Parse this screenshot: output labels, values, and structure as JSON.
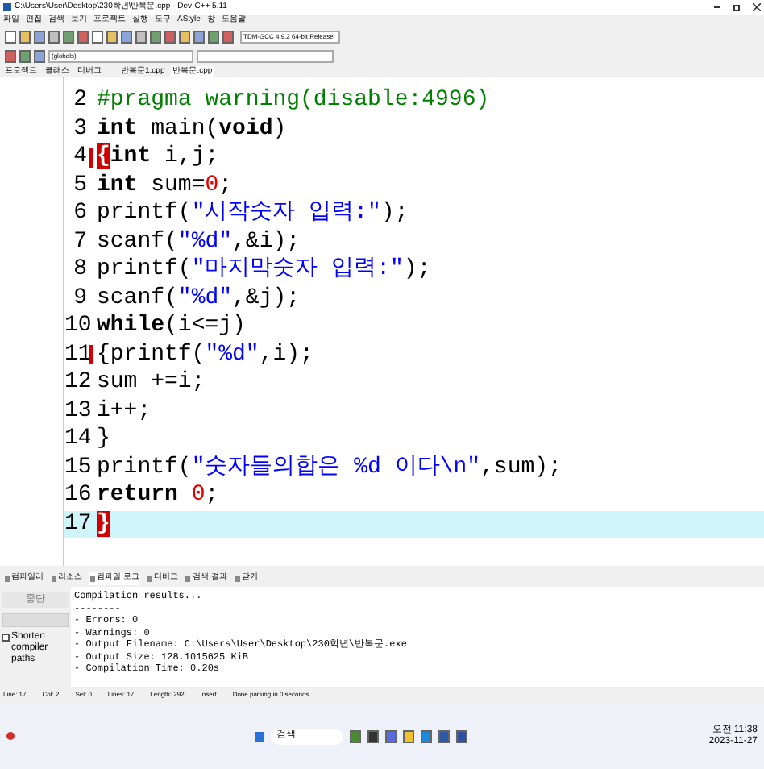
{
  "window": {
    "title": "C:\\Users\\User\\Desktop\\230학년\\반복문.cpp - Dev-C++ 5.11"
  },
  "menu": [
    "파일",
    "편집",
    "검색",
    "보기",
    "프로젝트",
    "실행",
    "도구",
    "AStyle",
    "창",
    "도움말"
  ],
  "compiler_select": {
    "value": "TDM-GCC 4.9.2 64-bit Release"
  },
  "class_select": {
    "value": "(globals)"
  },
  "side_tabs": [
    {
      "label": "프로젝트",
      "selected": false
    },
    {
      "label": "클래스",
      "selected": false
    },
    {
      "label": "디버그",
      "selected": false
    }
  ],
  "file_tabs": [
    {
      "label": "반복문1.cpp",
      "selected": false
    },
    {
      "label": "반복문.cpp",
      "selected": true
    }
  ],
  "editor": {
    "lines": [
      {
        "number": "2",
        "fold": false,
        "current": false,
        "segments": [
          {
            "kind": "pre",
            "text": "#pragma warning(disable:4996)"
          }
        ]
      },
      {
        "number": "3",
        "fold": false,
        "current": false,
        "segments": [
          {
            "kind": "kw",
            "text": "int"
          },
          {
            "kind": "plain",
            "text": " main("
          },
          {
            "kind": "kw",
            "text": "void"
          },
          {
            "kind": "plain",
            "text": ")"
          }
        ]
      },
      {
        "number": "4",
        "fold": true,
        "current": false,
        "segments": [
          {
            "kind": "match",
            "text": "{"
          },
          {
            "kind": "kw",
            "text": "int"
          },
          {
            "kind": "plain",
            "text": " i,j;"
          }
        ]
      },
      {
        "number": "5",
        "fold": false,
        "current": false,
        "segments": [
          {
            "kind": "kw",
            "text": "int"
          },
          {
            "kind": "plain",
            "text": " sum="
          },
          {
            "kind": "num",
            "text": "0"
          },
          {
            "kind": "plain",
            "text": ";"
          }
        ]
      },
      {
        "number": "6",
        "fold": false,
        "current": false,
        "segments": [
          {
            "kind": "plain",
            "text": "printf("
          },
          {
            "kind": "str",
            "text": "\"시작숫자 입력:\""
          },
          {
            "kind": "plain",
            "text": ");"
          }
        ]
      },
      {
        "number": "7",
        "fold": false,
        "current": false,
        "segments": [
          {
            "kind": "plain",
            "text": "scanf("
          },
          {
            "kind": "str",
            "text": "\"%d\""
          },
          {
            "kind": "plain",
            "text": ",&i);"
          }
        ]
      },
      {
        "number": "8",
        "fold": false,
        "current": false,
        "segments": [
          {
            "kind": "plain",
            "text": "printf("
          },
          {
            "kind": "str",
            "text": "\"마지막숫자 입력:\""
          },
          {
            "kind": "plain",
            "text": ");"
          }
        ]
      },
      {
        "number": "9",
        "fold": false,
        "current": false,
        "segments": [
          {
            "kind": "plain",
            "text": "scanf("
          },
          {
            "kind": "str",
            "text": "\"%d\""
          },
          {
            "kind": "plain",
            "text": ",&j);"
          }
        ]
      },
      {
        "number": "10",
        "fold": false,
        "current": false,
        "segments": [
          {
            "kind": "kw",
            "text": "while"
          },
          {
            "kind": "plain",
            "text": "(i<=j)"
          }
        ]
      },
      {
        "number": "11",
        "fold": true,
        "current": false,
        "segments": [
          {
            "kind": "plain",
            "text": "{printf("
          },
          {
            "kind": "str",
            "text": "\"%d\""
          },
          {
            "kind": "plain",
            "text": ",i);"
          }
        ]
      },
      {
        "number": "12",
        "fold": false,
        "current": false,
        "segments": [
          {
            "kind": "plain",
            "text": "sum +=i;"
          }
        ]
      },
      {
        "number": "13",
        "fold": false,
        "current": false,
        "segments": [
          {
            "kind": "plain",
            "text": "i++;"
          }
        ]
      },
      {
        "number": "14",
        "fold": false,
        "current": false,
        "segments": [
          {
            "kind": "plain",
            "text": "}"
          }
        ]
      },
      {
        "number": "15",
        "fold": false,
        "current": false,
        "segments": [
          {
            "kind": "plain",
            "text": "printf("
          },
          {
            "kind": "str",
            "text": "\"숫자들의합은 %d 이다\\n\""
          },
          {
            "kind": "plain",
            "text": ",sum);"
          }
        ]
      },
      {
        "number": "16",
        "fold": false,
        "current": false,
        "segments": [
          {
            "kind": "kw",
            "text": "return "
          },
          {
            "kind": "num",
            "text": "0"
          },
          {
            "kind": "plain",
            "text": ";"
          }
        ]
      },
      {
        "number": "17",
        "fold": false,
        "current": true,
        "segments": [
          {
            "kind": "match",
            "text": "}"
          }
        ]
      }
    ]
  },
  "bottom_tabs": [
    {
      "label": "컴파일러",
      "selected": false
    },
    {
      "label": "리소스",
      "selected": false
    },
    {
      "label": "컴파일 로그",
      "selected": true
    },
    {
      "label": "디버그",
      "selected": false
    },
    {
      "label": "검색 결과",
      "selected": false
    },
    {
      "label": "닫기",
      "selected": false
    }
  ],
  "abort_button": "중단",
  "progress": {
    "level": 0
  },
  "shorten_paths": {
    "label": "Shorten compiler paths",
    "checked": false
  },
  "compile_log": [
    "Compilation results...",
    "--------",
    "- Errors: 0",
    "- Warnings: 0",
    "- Output Filename: C:\\Users\\User\\Desktop\\230학년\\반복문.exe",
    "- Output Size: 128.1015625 KiB",
    "- Compilation Time: 0.20s"
  ],
  "status_bar": [
    "Line: 17",
    "Col: 2",
    "Sel: 0",
    "Lines: 17",
    "Length: 292",
    "Insert",
    "Done parsing in 0 seconds"
  ],
  "taskbar": {
    "search": "검색",
    "clock_time": "오전 11:38",
    "clock_date": "2023-11-27"
  }
}
